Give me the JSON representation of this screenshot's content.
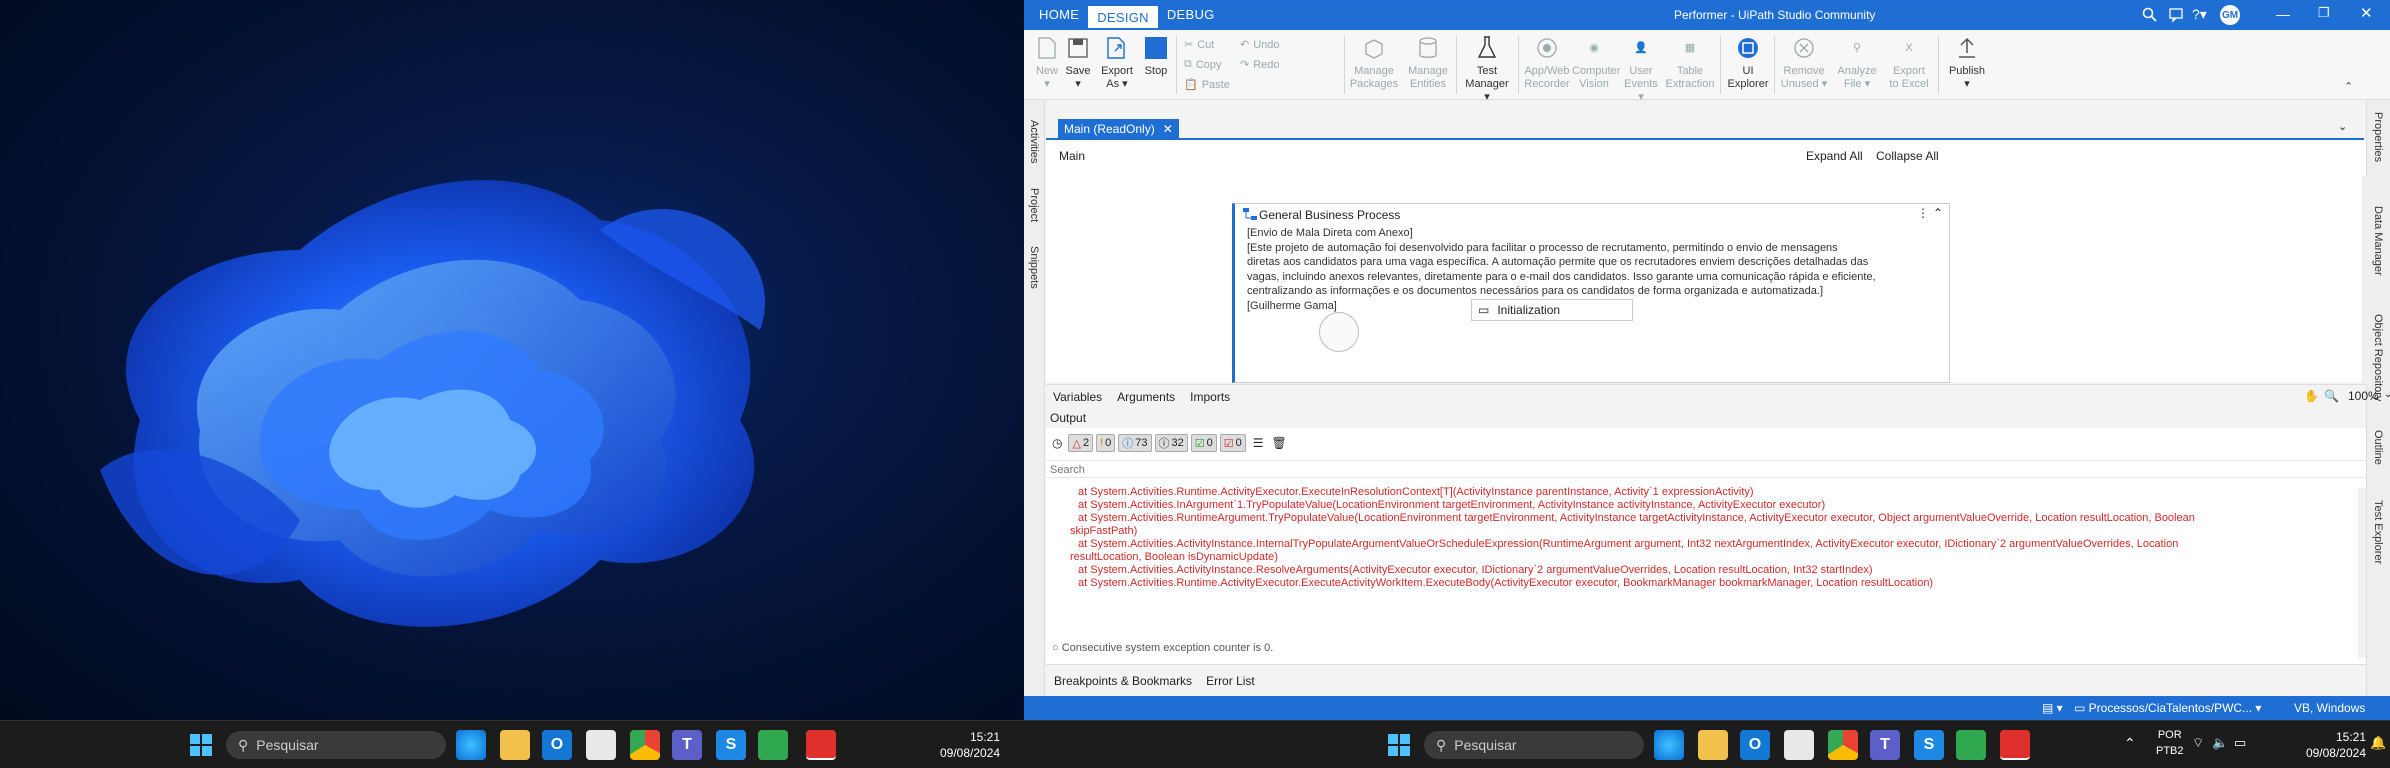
{
  "window_title": "Performer - UiPath Studio Community",
  "menu": {
    "home": "HOME",
    "design": "DESIGN",
    "debug": "DEBUG",
    "user": "GM"
  },
  "ribbon": {
    "new": "New",
    "save": "Save",
    "export1": "Export",
    "export2": "As",
    "stop": "Stop",
    "cut": "Cut",
    "copy": "Copy",
    "paste": "Paste",
    "undo": "Undo",
    "redo": "Redo",
    "manage_packages1": "Manage",
    "manage_packages2": "Packages",
    "manage_entities1": "Manage",
    "manage_entities2": "Entities",
    "test1": "Test",
    "test2": "Manager",
    "appweb1": "App/Web",
    "appweb2": "Recorder",
    "cv1": "Computer",
    "cv2": "Vision",
    "ue1": "User",
    "ue2": "Events",
    "te1": "Table",
    "te2": "Extraction",
    "uie1": "UI",
    "uie2": "Explorer",
    "ru1": "Remove",
    "ru2": "Unused",
    "af1": "Analyze",
    "af2": "File",
    "ee1": "Export",
    "ee2": "to Excel",
    "publish": "Publish"
  },
  "left_rail": {
    "activities": "Activities",
    "project": "Project",
    "snippets": "Snippets"
  },
  "right_rail": {
    "properties": "Properties",
    "data_manager": "Data Manager",
    "object_repository": "Object Repository",
    "outline": "Outline",
    "test_explorer": "Test Explorer"
  },
  "doc_tab": "Main (ReadOnly)",
  "breadcrumb": "Main",
  "expand_all": "Expand All",
  "collapse_all": "Collapse All",
  "card": {
    "title": "General Business Process",
    "l1": "[Envio de Mala Direta com Anexo]",
    "l2": "[Este projeto de automação foi desenvolvido para facilitar o processo de recrutamento, permitindo o envio de mensagens",
    "l3": "diretas aos candidatos para uma vaga específica. A automação permite que os recrutadores enviem descrições detalhadas das",
    "l4": "vagas, incluindo anexos relevantes, diretamente para o e-mail dos candidatos. Isso garante uma comunicação rápida e eficiente,",
    "l5": "centralizando as informações e os documentos necessários para os candidatos de forma organizada e automatizada.]",
    "l6": "[Guilherme Gama]",
    "init": "Initialization"
  },
  "panel_tabs": {
    "variables": "Variables",
    "arguments": "Arguments",
    "imports": "Imports",
    "zoom": "100%"
  },
  "output": {
    "title": "Output",
    "b1": "2",
    "b2": "0",
    "b3": "73",
    "b4": "32",
    "b5": "0",
    "b6": "0",
    "search": "Search",
    "lines": [
      "at System.Activities.Runtime.ActivityExecutor.ExecuteInResolutionContext[T](ActivityInstance parentInstance, Activity`1 expressionActivity)",
      "at System.Activities.InArgument`1.TryPopulateValue(LocationEnvironment targetEnvironment, ActivityInstance activityInstance, ActivityExecutor executor)",
      "at System.Activities.RuntimeArgument.TryPopulateValue(LocationEnvironment targetEnvironment, ActivityInstance targetActivityInstance, ActivityExecutor executor, Object argumentValueOverride, Location resultLocation, Boolean",
      "skipFastPath)",
      "at System.Activities.ActivityInstance.InternalTryPopulateArgumentValueOrScheduleExpression(RuntimeArgument argument, Int32 nextArgumentIndex, ActivityExecutor executor, IDictionary`2 argumentValueOverrides, Location",
      "resultLocation, Boolean isDynamicUpdate)",
      "at System.Activities.ActivityInstance.ResolveArguments(ActivityExecutor executor, IDictionary`2 argumentValueOverrides, Location resultLocation, Int32 startIndex)",
      "at System.Activities.Runtime.ActivityExecutor.ExecuteActivityWorkItem.ExecuteBody(ActivityExecutor executor, BookmarkManager bookmarkManager, Location resultLocation)"
    ],
    "info": "Consecutive system exception counter is 0."
  },
  "bottom_tabs": {
    "breakpoints": "Breakpoints & Bookmarks",
    "errors": "Error List"
  },
  "status": {
    "path": "Processos/CiaTalentos/PWC...",
    "env": "VB, Windows"
  },
  "taskbar_left": {
    "search": "Pesquisar",
    "time": "15:21",
    "date": "09/08/2024"
  },
  "taskbar_right": {
    "search": "Pesquisar",
    "lang1": "POR",
    "lang2": "PTB2",
    "time": "15:21",
    "date": "09/08/2024"
  }
}
